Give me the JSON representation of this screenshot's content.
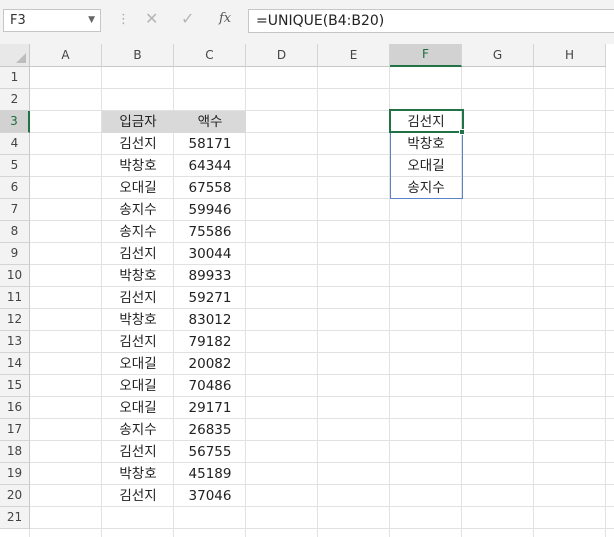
{
  "name_box": {
    "value": "F3"
  },
  "formula_bar": {
    "cancel_icon": "✕",
    "enter_icon": "✓",
    "fx_label": "fx",
    "formula": "=UNIQUE(B4:B20)"
  },
  "columns": [
    "A",
    "B",
    "C",
    "D",
    "E",
    "F",
    "G",
    "H"
  ],
  "selected_column": "F",
  "rows": [
    "1",
    "2",
    "3",
    "4",
    "5",
    "6",
    "7",
    "8",
    "9",
    "10",
    "11",
    "12",
    "13",
    "14",
    "15",
    "16",
    "17",
    "18",
    "19",
    "20",
    "21"
  ],
  "selected_row": "3",
  "table": {
    "headers": {
      "name": "입금자",
      "amount": "액수"
    },
    "rows": [
      {
        "name": "김선지",
        "amount": "58171"
      },
      {
        "name": "박창호",
        "amount": "64344"
      },
      {
        "name": "오대길",
        "amount": "67558"
      },
      {
        "name": "송지수",
        "amount": "59946"
      },
      {
        "name": "송지수",
        "amount": "75586"
      },
      {
        "name": "김선지",
        "amount": "30044"
      },
      {
        "name": "박창호",
        "amount": "89933"
      },
      {
        "name": "김선지",
        "amount": "59271"
      },
      {
        "name": "박창호",
        "amount": "83012"
      },
      {
        "name": "김선지",
        "amount": "79182"
      },
      {
        "name": "오대길",
        "amount": "20082"
      },
      {
        "name": "오대길",
        "amount": "70486"
      },
      {
        "name": "오대길",
        "amount": "29171"
      },
      {
        "name": "송지수",
        "amount": "26835"
      },
      {
        "name": "김선지",
        "amount": "56755"
      },
      {
        "name": "박창호",
        "amount": "45189"
      },
      {
        "name": "김선지",
        "amount": "37046"
      }
    ]
  },
  "unique_result": [
    "김선지",
    "박창호",
    "오대길",
    "송지수"
  ],
  "colors": {
    "selection": "#217346",
    "spill_border": "#5b83c5",
    "header_fill": "#d9d9d9"
  }
}
